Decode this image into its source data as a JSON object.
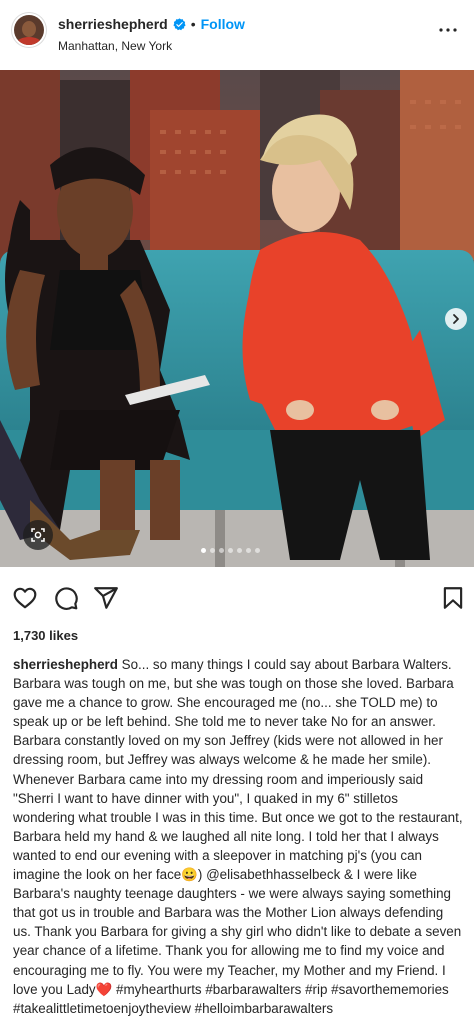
{
  "header": {
    "username": "sherrieshepherd",
    "separator": "•",
    "follow_label": "Follow",
    "location": "Manhattan, New York"
  },
  "carousel": {
    "slide_count": 7,
    "active_slide": 1
  },
  "post": {
    "likes": "1,730 likes",
    "caption_user": "sherrieshepherd",
    "caption_text": "So... so many things I could say about Barbara Walters. Barbara was tough on me, but she was tough on those she loved. Barbara gave me a chance to grow. She encouraged me (no... she TOLD me) to speak up or be left behind. She told me to never take No for an answer. Barbara constantly loved on my son Jeffrey (kids were not allowed in her dressing room, but Jeffrey was always welcome & he made her smile). Whenever Barbara came into my dressing room and imperiously said \"Sherri I want to have dinner with you\", I quaked in my 6\" stilletos wondering what trouble I was in this time. But once we got to the restaurant, Barbara held my hand & we laughed all nite long. I told her that I always wanted to end our evening with a sleepover in matching pj's (you can imagine the look on her face😀) @elisabethhasselbeck & I were like Barbara's naughty teenage daughters - we were always saying something that got us in trouble and Barbara was the Mother Lion always defending us. Thank you Barbara for giving a shy girl who didn't like to debate a seven year chance of a lifetime. Thank you for allowing me to find my voice and encouraging me to fly. You were my Teacher, my Mother and my Friend. I love you Lady❤️ #myhearthurts #barbarawalters #rip #savorthememories #takealittletimetoenjoytheview #helloimbarbarawalters"
  },
  "colors": {
    "accent": "#0095f6",
    "text": "#262626",
    "verified": "#0095f6"
  },
  "icons": [
    "verified-badge-icon",
    "more-options-icon",
    "carousel-next-icon",
    "multi-image-icon",
    "heart-icon",
    "comment-icon",
    "share-icon",
    "bookmark-icon"
  ]
}
